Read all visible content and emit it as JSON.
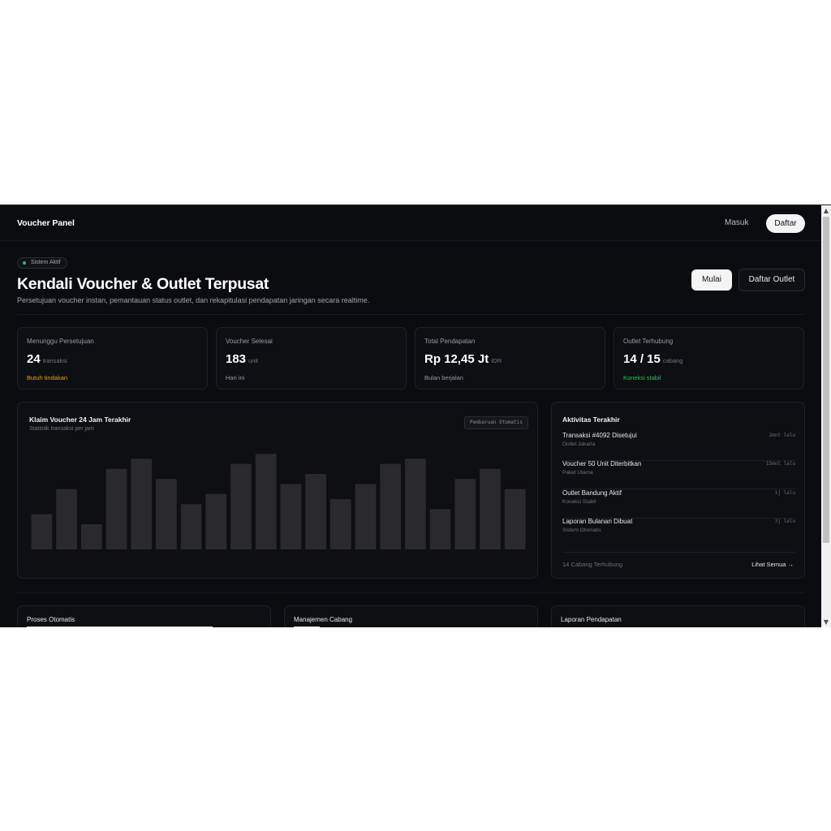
{
  "navbar": {
    "brand": "Voucher Panel",
    "login_label": "Masuk",
    "register_label": "Daftar"
  },
  "hero": {
    "badge": "Sistem Aktif",
    "title": "Kendali Voucher & Outlet Terpusat",
    "subtitle": "Persetujuan voucher instan, pemantauan status outlet, dan rekapitulasi pendapatan jaringan secara realtime.",
    "start_label": "Mulai",
    "outlet_label": "Daftar Outlet"
  },
  "stats": [
    {
      "label": "Menunggu Persetujuan",
      "value": "24",
      "unit": "transaksi",
      "note": "Butuh tindakan",
      "note_color": "#f59e0b"
    },
    {
      "label": "Voucher Selesai",
      "value": "183",
      "unit": "unit",
      "note": "Hari ini",
      "note_color": "#9a9ba2"
    },
    {
      "label": "Total Pendapatan",
      "value": "Rp 12,45 Jt",
      "unit": "IDR",
      "note": "Bulan berjalan",
      "note_color": "#9a9ba2"
    },
    {
      "label": "Outlet Terhubung",
      "value": "14 / 15",
      "unit": "cabang",
      "note": "Koneksi stabil",
      "note_color": "#22c55e"
    }
  ],
  "chart": {
    "title": "Klaim Voucher 24 Jam Terakhir",
    "subtitle": "Statistik transaksi per jam",
    "tag": "Pembaruan Otomatis"
  },
  "chart_data": {
    "type": "bar",
    "values": [
      35,
      60,
      25,
      80,
      90,
      70,
      45,
      55,
      85,
      95,
      65,
      75,
      50,
      65,
      85,
      90,
      40,
      70,
      80,
      60
    ],
    "ylim": [
      0,
      100
    ],
    "grid": false,
    "bar_color": "#2a2a2e"
  },
  "activity": {
    "title": "Aktivitas Terakhir",
    "items": [
      {
        "name": "Transaksi #4092 Disetujui",
        "meta": "Outlet Jakarta",
        "time": "2mnt lalu"
      },
      {
        "name": "Voucher 50 Unit Diterbitkan",
        "meta": "Paket Utama",
        "time": "15mnt lalu"
      },
      {
        "name": "Outlet Bandung Aktif",
        "meta": "Koneksi Stabil",
        "time": "1j lalu"
      },
      {
        "name": "Laporan Bulanan Dibuat",
        "meta": "Sistem Otomatis",
        "time": "3j lalu"
      }
    ],
    "footer_left": "14 Cabang Terhubung",
    "footer_right": "Lihat Semua →"
  },
  "bottom_cards": [
    {
      "title": "Proses Otomatis"
    },
    {
      "title": "Manajemen Cabang"
    },
    {
      "title": "Laporan Pendapatan"
    }
  ],
  "scrollbar": {
    "up_glyph": "▲",
    "down_glyph": "▼"
  }
}
